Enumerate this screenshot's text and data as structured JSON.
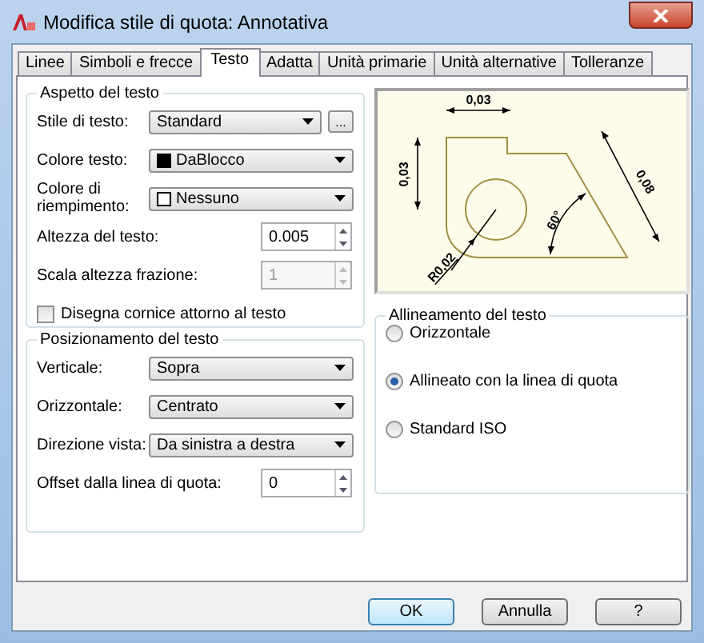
{
  "window": {
    "title": "Modifica stile di quota: Annotativa"
  },
  "tabs": [
    {
      "label": "Linee",
      "selected": false
    },
    {
      "label": "Simboli e frecce",
      "selected": false
    },
    {
      "label": "Testo",
      "selected": true
    },
    {
      "label": "Adatta",
      "selected": false
    },
    {
      "label": "Unità primarie",
      "selected": false
    },
    {
      "label": "Unità alternative",
      "selected": false
    },
    {
      "label": "Tolleranze",
      "selected": false
    }
  ],
  "text_appearance": {
    "title": "Aspetto del testo",
    "fields": [
      {
        "kind": "select",
        "label": "Stile di testo:",
        "value": "Standard",
        "browse_button": "..."
      },
      {
        "kind": "select",
        "label": "Colore testo:",
        "value": "DaBlocco",
        "color": "#000000"
      },
      {
        "kind": "select",
        "label": "Colore di riempimento:",
        "value": "Nessuno",
        "color": "#ffffff"
      },
      {
        "kind": "spin",
        "label": "Altezza del testo:",
        "value": "0.005",
        "disabled": false
      },
      {
        "kind": "spin",
        "label": "Scala altezza frazione:",
        "value": "1",
        "disabled": true
      },
      {
        "kind": "checkbox",
        "label": "Disegna cornice attorno al testo",
        "checked": false
      }
    ]
  },
  "text_placement": {
    "title": "Posizionamento del testo",
    "fields": [
      {
        "kind": "select",
        "label": "Verticale:",
        "value": "Sopra"
      },
      {
        "kind": "select",
        "label": "Orizzontale:",
        "value": "Centrato"
      },
      {
        "kind": "select",
        "label": "Direzione vista:",
        "value": "Da sinistra a destra"
      },
      {
        "kind": "spin",
        "label": "Offset dalla linea di quota:",
        "value": "0",
        "disabled": false
      }
    ]
  },
  "preview": {
    "labels": [
      "0,03",
      "0,03",
      "0,08",
      "60°",
      "R0,02"
    ]
  },
  "text_alignment": {
    "title": "Allineamento del testo",
    "options": [
      {
        "label": "Orizzontale",
        "selected": false
      },
      {
        "label": "Allineato con la linea di quota",
        "selected": true
      },
      {
        "label": "Standard ISO",
        "selected": false
      }
    ]
  },
  "buttons": [
    "OK",
    "Annulla",
    "?"
  ]
}
